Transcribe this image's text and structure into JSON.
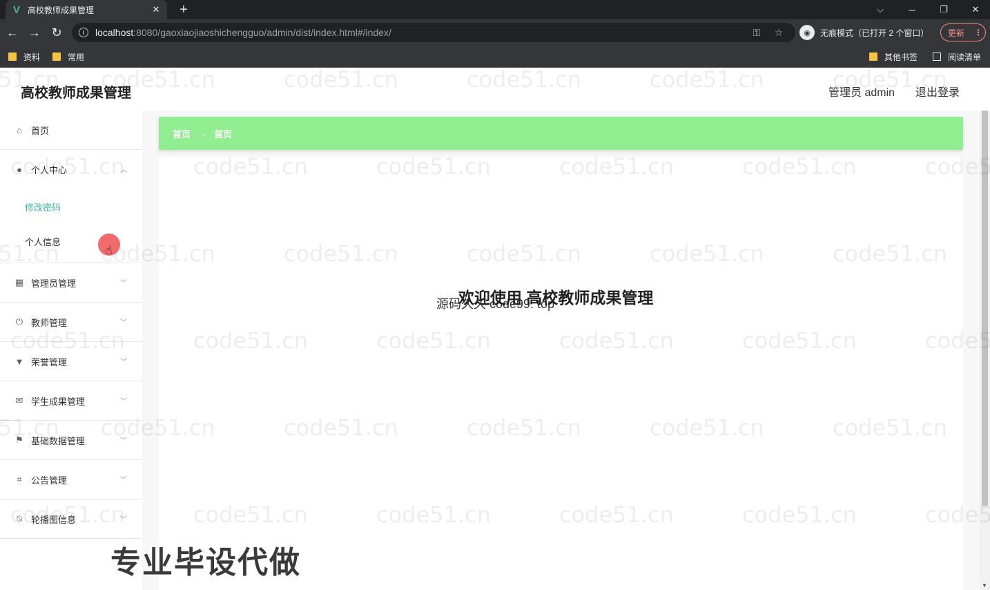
{
  "browser": {
    "tab_title": "高校教师成果管理",
    "tab_favicon": "V",
    "url_host": "localhost",
    "url_rest": ":8080/gaoxiaojiaoshichengguo/admin/dist/index.html#/index/",
    "incognito_label": "无痕模式（已打开 2 个窗口）",
    "update_label": "更新",
    "bookmarks": [
      "资料",
      "常用"
    ],
    "bookmarks_right": [
      "其他书签",
      "阅读清单"
    ]
  },
  "header": {
    "title": "高校教师成果管理",
    "user": "管理员 admin",
    "logout": "退出登录"
  },
  "sidebar": {
    "items": [
      {
        "label": "首页",
        "icon": "home-icon"
      },
      {
        "label": "个人中心",
        "icon": "user-icon",
        "expanded": true,
        "children": [
          {
            "label": "修改密码",
            "active": true
          },
          {
            "label": "个人信息",
            "active": false
          }
        ]
      },
      {
        "label": "管理员管理",
        "icon": "grid-icon"
      },
      {
        "label": "教师管理",
        "icon": "power-icon"
      },
      {
        "label": "荣誉管理",
        "icon": "trophy-icon"
      },
      {
        "label": "学生成果管理",
        "icon": "mail-icon"
      },
      {
        "label": "基础数据管理",
        "icon": "flag-icon"
      },
      {
        "label": "公告管理",
        "icon": "crop-icon"
      },
      {
        "label": "轮播图信息",
        "icon": "mute-bell-icon"
      }
    ]
  },
  "breadcrumb": {
    "home": "首页",
    "current": "首页"
  },
  "main": {
    "welcome": "欢迎使用 高校教师成果管理",
    "source": "源码久久 code99. top"
  },
  "watermark": "code51.cn",
  "overlay_text": "专业毕设代做",
  "colors": {
    "breadcrumb_bg": "#90ee90",
    "active_menu": "#3cb4a0",
    "cursor_highlight": "#f05050"
  }
}
